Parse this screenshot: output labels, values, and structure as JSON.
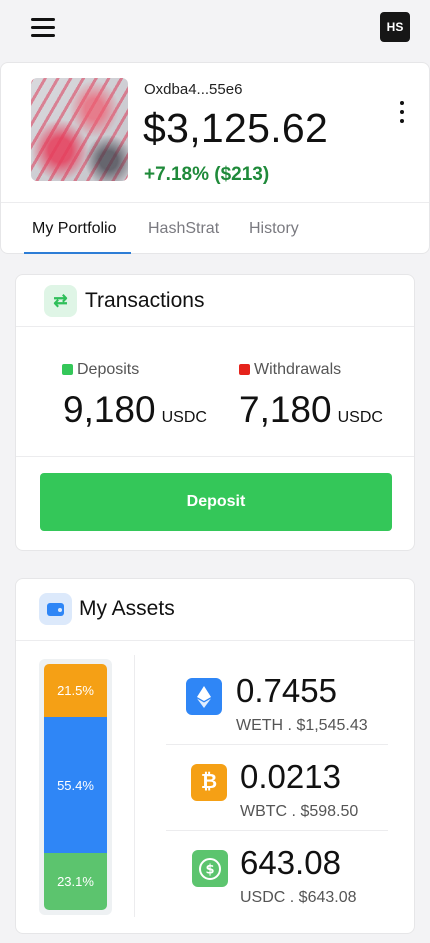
{
  "header": {
    "avatar_initials": "HS",
    "menu_icon": "hamburger-menu-icon"
  },
  "profile": {
    "wallet_address": "Oxdba4...55e6",
    "balance": "$3,125.62",
    "change": "+7.18% ($213)",
    "more_icon": "kebab-menu-icon"
  },
  "tabs": [
    {
      "label": "My Portfolio",
      "active": true
    },
    {
      "label": "HashStrat",
      "active": false
    },
    {
      "label": "History",
      "active": false
    }
  ],
  "transactions": {
    "title": "Transactions",
    "icon": "swap-arrows-icon",
    "deposits": {
      "label": "Deposits",
      "value": "9,180",
      "unit": "USDC",
      "color": "#34c759"
    },
    "withdrawals": {
      "label": "Withdrawals",
      "value": "7,180",
      "unit": "USDC",
      "color": "#e5231b"
    },
    "deposit_button": "Deposit"
  },
  "assets": {
    "title": "My Assets",
    "icon": "wallet-icon",
    "allocation": [
      {
        "label": "21.5%",
        "percent": 21.5,
        "color": "#f5a015"
      },
      {
        "label": "55.4%",
        "percent": 55.4,
        "color": "#2f86f6"
      },
      {
        "label": "23.1%",
        "percent": 23.1,
        "color": "#5cc46e"
      }
    ],
    "items": [
      {
        "amount": "0.7455",
        "sub": "WETH . $1,545.43",
        "icon": "ethereum-icon",
        "color": "#2f86f6"
      },
      {
        "amount": "0.0213",
        "sub": "WBTC . $598.50",
        "icon": "bitcoin-icon",
        "color": "#f5a015"
      },
      {
        "amount": "643.08",
        "sub": "USDC . $643.08",
        "icon": "usdc-dollar-icon",
        "color": "#5cc46e"
      }
    ]
  }
}
